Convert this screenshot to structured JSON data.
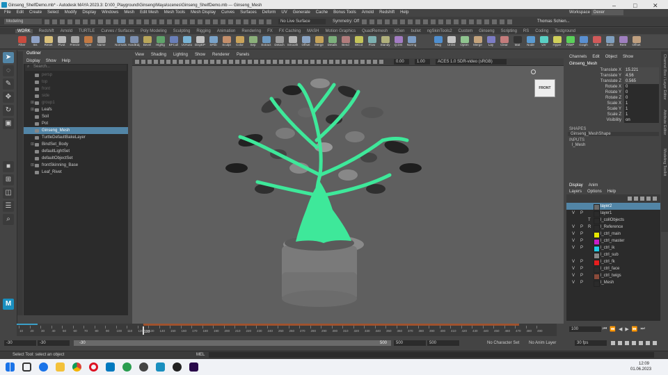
{
  "window": {
    "title": "Ginseng_ShelfDemo.mb* - Autodesk MAYA 2023.3: D:\\00_Playground\\Ginseng\\Maya\\scenes\\Ginseng_ShelfDemo.mb  ---  Ginseng_Mesh"
  },
  "menubar": {
    "items": [
      "File",
      "Edit",
      "Create",
      "Select",
      "Modify",
      "Display",
      "Windows",
      "Mesh",
      "Edit Mesh",
      "Mesh Tools",
      "Mesh Display",
      "Curves",
      "Surfaces",
      "Deform",
      "UV",
      "Generate",
      "Cache",
      "Bonus Tools",
      "Arnold",
      "Redshift",
      "Help"
    ],
    "workspace_label": "Workspace :",
    "workspace_value": "Dexer"
  },
  "statusline": {
    "mode": "Modeling",
    "live_surface": "No Live Surface",
    "symmetry": "Symmetry: Off",
    "user": "Thomas Schien..."
  },
  "shelftabs": [
    "WORK",
    "Redshift",
    "Arnold",
    "TURTLE",
    "Curves / Surfaces",
    "Poly Modeling",
    "Sculpting",
    "Rigging",
    "Animation",
    "Rendering",
    "FX",
    "FX Caching",
    "MASH",
    "Motion Graphics",
    "QuadRemesh",
    "XGen",
    "bullet",
    "ngSkinTools2",
    "Custom",
    "Ginseng",
    "Scripting",
    "RS",
    "Coding",
    "Testground"
  ],
  "shelf": {
    "left": [
      {
        "label": "Filter",
        "color": "#c94b3f"
      },
      {
        "label": "Ins",
        "color": "#8fa2c6"
      },
      {
        "label": "Reset",
        "color": "#d9c07a"
      },
      {
        "label": "Pivot",
        "color": "#b8b8b8"
      },
      {
        "label": "Freeze",
        "color": "#a9a9a9"
      },
      {
        "label": "Type",
        "color": "#c27a44"
      },
      {
        "label": "Name",
        "color": "#9e9e9e"
      }
    ],
    "middle": [
      {
        "label": "Normals",
        "color": "#77a0c9"
      },
      {
        "label": "HardEdge",
        "color": "#7c8fb0"
      },
      {
        "label": "Bevel",
        "color": "#b8a65a"
      },
      {
        "label": "Hlghlg",
        "color": "#5fa36a"
      },
      {
        "label": "BFCull",
        "color": "#6a7fb8"
      },
      {
        "label": "UVAuto",
        "color": "#79b3d4"
      },
      {
        "label": "DispEP",
        "color": "#c2c2c2"
      },
      {
        "label": "SFlib",
        "color": "#7aa3c9"
      },
      {
        "label": "Sculpt",
        "color": "#c48f6b"
      },
      {
        "label": "Color",
        "color": "#c9a35a"
      },
      {
        "label": "Sep",
        "color": "#8bb07a"
      },
      {
        "label": "Extract",
        "color": "#6d9ac2"
      },
      {
        "label": "Detach",
        "color": "#9c9c9c"
      },
      {
        "label": "Smooth",
        "color": "#b6b6b6"
      },
      {
        "label": "Offset",
        "color": "#8aa4c4"
      },
      {
        "label": "Merge",
        "color": "#c4a35a"
      },
      {
        "label": "Details",
        "color": "#7cb07c"
      },
      {
        "label": "Bend",
        "color": "#b07c7c"
      },
      {
        "label": "WCut",
        "color": "#c4c45a"
      },
      {
        "label": "Flow",
        "color": "#7cb0b0"
      },
      {
        "label": "Standy",
        "color": "#b0b07c"
      },
      {
        "label": "Q.Dm",
        "color": "#a37cc4"
      },
      {
        "label": "Normg",
        "color": "#7c9cc4"
      }
    ],
    "right": [
      {
        "label": "Mug",
        "color": "#4f8fd0"
      },
      {
        "label": "Unlist",
        "color": "#c4c4c4"
      },
      {
        "label": "OptIm",
        "color": "#8fc48f"
      },
      {
        "label": "Merge",
        "color": "#c4a37c"
      },
      {
        "label": "Lay",
        "color": "#7c7cc4"
      },
      {
        "label": "Clear",
        "color": "#c47c7c"
      },
      {
        "label": "Mat",
        "color": "#333333"
      },
      {
        "label": "Node",
        "color": "#5a9ad0"
      },
      {
        "label": "UV",
        "color": "#5ad0c4"
      },
      {
        "label": "Hyper",
        "color": "#d0d05a"
      },
      {
        "label": "FilteP",
        "color": "#5ad05a"
      },
      {
        "label": "Graph",
        "color": "#5a8fd0"
      },
      {
        "label": "CE",
        "color": "#d05a5a"
      },
      {
        "label": "Build",
        "color": "#7f9fbf"
      },
      {
        "label": "Rem",
        "color": "#9f7fbf"
      },
      {
        "label": "Offset",
        "color": "#bf9f7f"
      }
    ]
  },
  "outliner": {
    "title": "Outliner",
    "menu": [
      "Display",
      "Show",
      "Help"
    ],
    "search_placeholder": "Search...",
    "items": [
      {
        "name": "persp",
        "dim": true,
        "icon": "camera-icon",
        "indent": 0
      },
      {
        "name": "top",
        "dim": true,
        "icon": "camera-icon",
        "indent": 0
      },
      {
        "name": "front",
        "dim": true,
        "icon": "camera-icon",
        "indent": 0
      },
      {
        "name": "side",
        "dim": true,
        "icon": "camera-icon",
        "indent": 0
      },
      {
        "name": "group1",
        "dim": true,
        "icon": "group-icon",
        "indent": 0,
        "expand": true
      },
      {
        "name": "Leafs",
        "dim": false,
        "icon": "group-icon",
        "indent": 0,
        "expand": true
      },
      {
        "name": "Soil",
        "dim": false,
        "icon": "mesh-icon",
        "indent": 0
      },
      {
        "name": "Pot",
        "dim": false,
        "icon": "mesh-icon",
        "indent": 0
      },
      {
        "name": "Ginseng_Mesh",
        "dim": false,
        "icon": "mesh-icon",
        "indent": 0,
        "selected": true
      },
      {
        "name": "TurtleDefaultBakeLayer",
        "dim": false,
        "icon": "layer-icon",
        "indent": 0
      },
      {
        "name": "BindSet_Body",
        "dim": false,
        "icon": "set-icon",
        "indent": 0,
        "expand": true
      },
      {
        "name": "defaultLightSet",
        "dim": false,
        "icon": "set-icon",
        "indent": 0
      },
      {
        "name": "defaultObjectSet",
        "dim": false,
        "icon": "set-icon",
        "indent": 0
      },
      {
        "name": "frontSkinning_Base",
        "dim": false,
        "icon": "set-icon",
        "indent": 0,
        "expand": true
      },
      {
        "name": "Leaf_Rivet",
        "dim": false,
        "icon": "mesh-icon",
        "indent": 0
      }
    ]
  },
  "viewport": {
    "menu": [
      "View",
      "Shading",
      "Lighting",
      "Show",
      "Renderer",
      "Panels"
    ],
    "exposure": "0.00",
    "gamma": "1.00",
    "colorspace": "ACES 1.0 SDR-video (sRGB)",
    "viewcube": "FRONT"
  },
  "channelbox": {
    "tabs": [
      "Channels",
      "Edit",
      "Object",
      "Show"
    ],
    "object": "Ginseng_Mesh",
    "attrs": [
      {
        "name": "Translate X",
        "value": "15.221"
      },
      {
        "name": "Translate Y",
        "value": "4.56"
      },
      {
        "name": "Translate Z",
        "value": "0.565"
      },
      {
        "name": "Rotate X",
        "value": "0"
      },
      {
        "name": "Rotate Y",
        "value": "0"
      },
      {
        "name": "Rotate Z",
        "value": "0"
      },
      {
        "name": "Scale X",
        "value": "1"
      },
      {
        "name": "Scale Y",
        "value": "1"
      },
      {
        "name": "Scale Z",
        "value": "1"
      },
      {
        "name": "Visibility",
        "value": "on"
      }
    ],
    "shapes_header": "SHAPES",
    "shape": "Ginseng_MeshShape",
    "inputs_header": "INPUTS",
    "input": "l_Mesh"
  },
  "layers": {
    "tabs": [
      "Display",
      "Anim"
    ],
    "menu": [
      "Layers",
      "Options",
      "Help"
    ],
    "rows": [
      {
        "v": "",
        "p": "",
        "r": "",
        "color": "#6a6a6a",
        "name": "layer2",
        "selected": true
      },
      {
        "v": "V",
        "p": "P",
        "r": "",
        "color": "",
        "name": "layer1"
      },
      {
        "v": "",
        "p": "",
        "r": "T",
        "color": "",
        "name": "l_collObjects"
      },
      {
        "v": "V",
        "p": "P",
        "r": "R",
        "color": "",
        "name": "l_Reference"
      },
      {
        "v": "V",
        "p": "P",
        "r": "",
        "color": "#e6e600",
        "name": "l_ctrl_main"
      },
      {
        "v": "V",
        "p": "P",
        "r": "",
        "color": "#c81ec8",
        "name": "l_ctrl_master"
      },
      {
        "v": "V",
        "p": "P",
        "r": "",
        "color": "#1ecbe6",
        "name": "l_ctrl_ik"
      },
      {
        "v": "",
        "p": "",
        "r": "",
        "color": "#888888",
        "name": "l_ctrl_sub"
      },
      {
        "v": "V",
        "p": "P",
        "r": "",
        "color": "#e61e1e",
        "name": "l_ctrl_fk"
      },
      {
        "v": "V",
        "p": "P",
        "r": "",
        "color": "",
        "name": "l_ctrl_face"
      },
      {
        "v": "V",
        "p": "P",
        "r": "",
        "color": "#8a4a3a",
        "name": "l_ctrl_twigs"
      },
      {
        "v": "V",
        "p": "P",
        "r": "",
        "color": "",
        "name": "l_Mesh"
      }
    ]
  },
  "sidetabs": [
    "Channel Box / Layer Editor",
    "Attribute Editor",
    "Modeling Toolkit"
  ],
  "timeline": {
    "ticks": [
      "10",
      "20",
      "30",
      "40",
      "50",
      "60",
      "70",
      "80",
      "90",
      "100",
      "110",
      "120",
      "130",
      "140",
      "150",
      "160",
      "170",
      "180",
      "190",
      "200",
      "210",
      "220",
      "230",
      "240",
      "250",
      "260",
      "270",
      "280",
      "290",
      "300",
      "310",
      "320",
      "330",
      "340",
      "350",
      "360",
      "370",
      "380",
      "390",
      "400",
      "410",
      "420",
      "430",
      "440",
      "450",
      "460",
      "470",
      "480",
      "490"
    ],
    "current_frame": "100",
    "frame_field": "100"
  },
  "range": {
    "start": "-30",
    "inner_start": "-30",
    "slider_start": "-30",
    "slider_end": "500",
    "inner_end": "500",
    "end": "500",
    "character_set": "No Character Set",
    "anim_layer": "No Anim Layer",
    "fps": "30 fps"
  },
  "cmdline": {
    "help": "Select Tool: select an object",
    "lang": "MEL"
  },
  "taskbar": {
    "time": "12:09",
    "date": "01.06.2023"
  }
}
